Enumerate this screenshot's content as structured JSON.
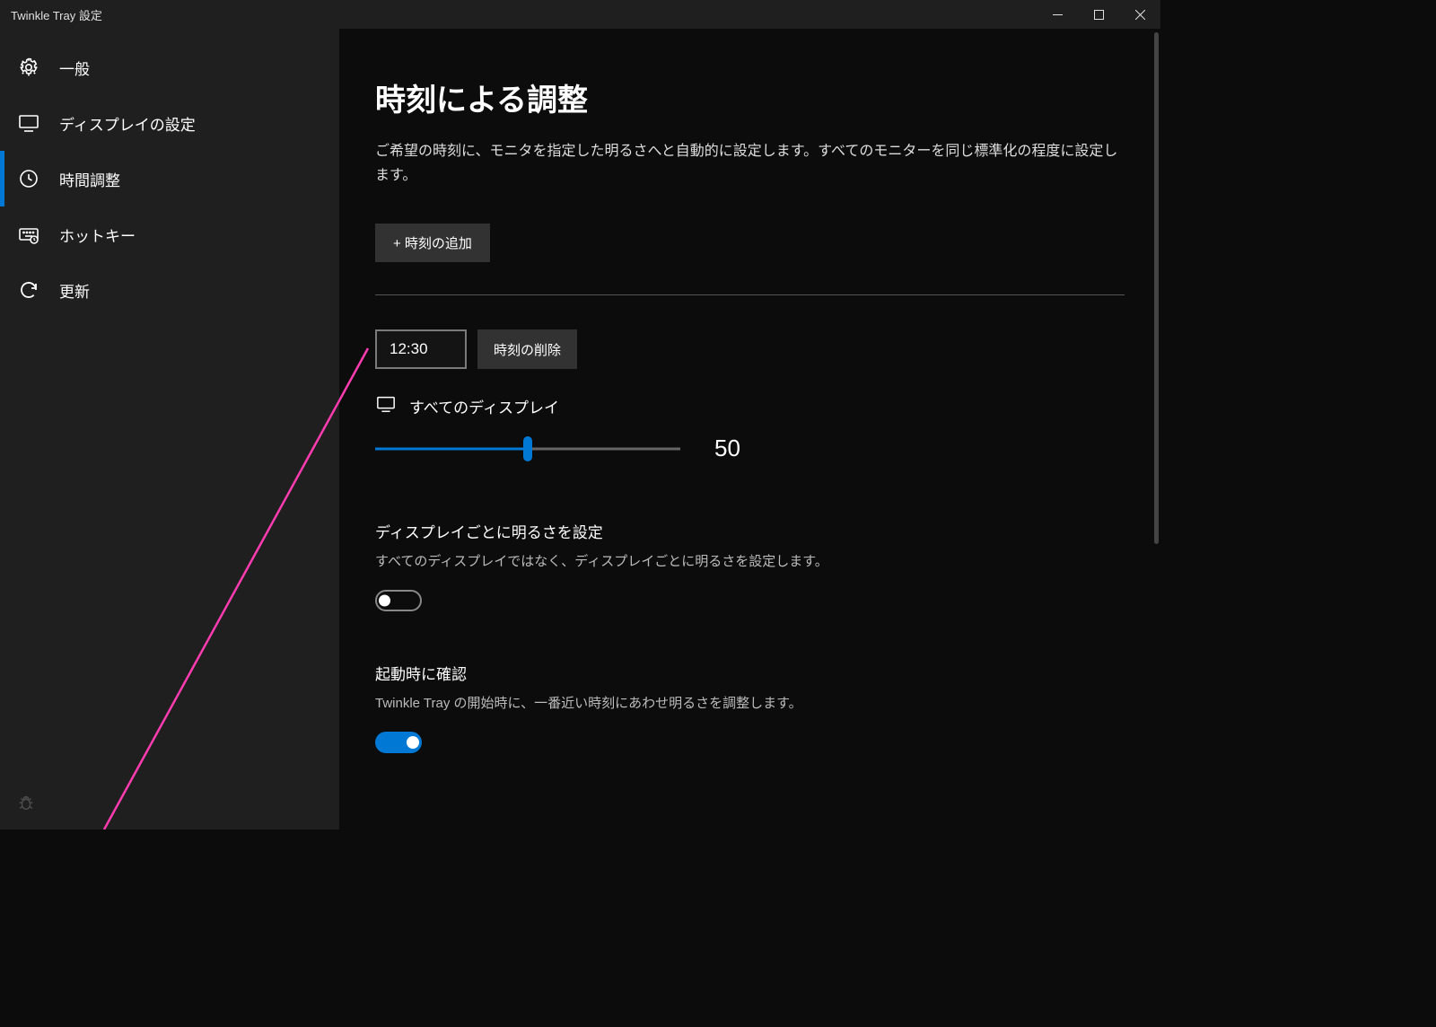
{
  "titlebar": {
    "title": "Twinkle Tray 設定"
  },
  "sidebar": {
    "items": [
      {
        "label": "一般",
        "icon": "gear",
        "selected": false
      },
      {
        "label": "ディスプレイの設定",
        "icon": "monitor",
        "selected": false
      },
      {
        "label": "時間調整",
        "icon": "clock",
        "selected": true
      },
      {
        "label": "ホットキー",
        "icon": "keyboard",
        "selected": false
      },
      {
        "label": "更新",
        "icon": "refresh",
        "selected": false
      }
    ],
    "debug_icon": "bug"
  },
  "main": {
    "title": "時刻による調整",
    "description": "ご希望の時刻に、モニタを指定した明るさへと自動的に設定します。すべてのモニターを同じ標準化の程度に設定します。",
    "add_time_label": "+ 時刻の追加",
    "time_entry": {
      "time_value": "12:30",
      "remove_label": "時刻の削除",
      "all_displays_label": "すべてのディスプレイ",
      "brightness_value": "50",
      "brightness_percent": 50
    },
    "per_display": {
      "title": "ディスプレイごとに明るさを設定",
      "description": "すべてのディスプレイではなく、ディスプレイごとに明るさを設定します。",
      "enabled": false
    },
    "check_startup": {
      "title": "起動時に確認",
      "description": "Twinkle Tray の開始時に、一番近い時刻にあわせ明るさを調整します。",
      "enabled": true
    }
  }
}
